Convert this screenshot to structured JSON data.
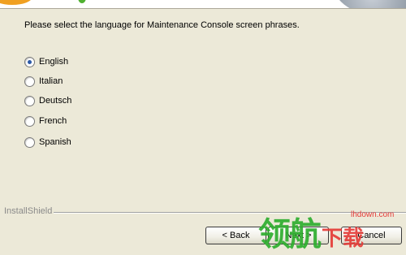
{
  "header": {
    "colors": {
      "accent_orange": "#f0a020",
      "accent_green": "#4fb030"
    }
  },
  "instruction": "Please select the language for Maintenance Console screen phrases.",
  "languages": [
    {
      "label": "English",
      "selected": true
    },
    {
      "label": "Italian",
      "selected": false
    },
    {
      "label": "Deutsch",
      "selected": false
    },
    {
      "label": "French",
      "selected": false
    },
    {
      "label": "Spanish",
      "selected": false
    }
  ],
  "footer": {
    "brand": "InstallShield",
    "back_label": "< Back",
    "next_label": "Next >",
    "cancel_label": "Cancel"
  },
  "watermark": {
    "domain": "lhdown.com",
    "logo_big": "领航",
    "logo_small": "下载"
  }
}
